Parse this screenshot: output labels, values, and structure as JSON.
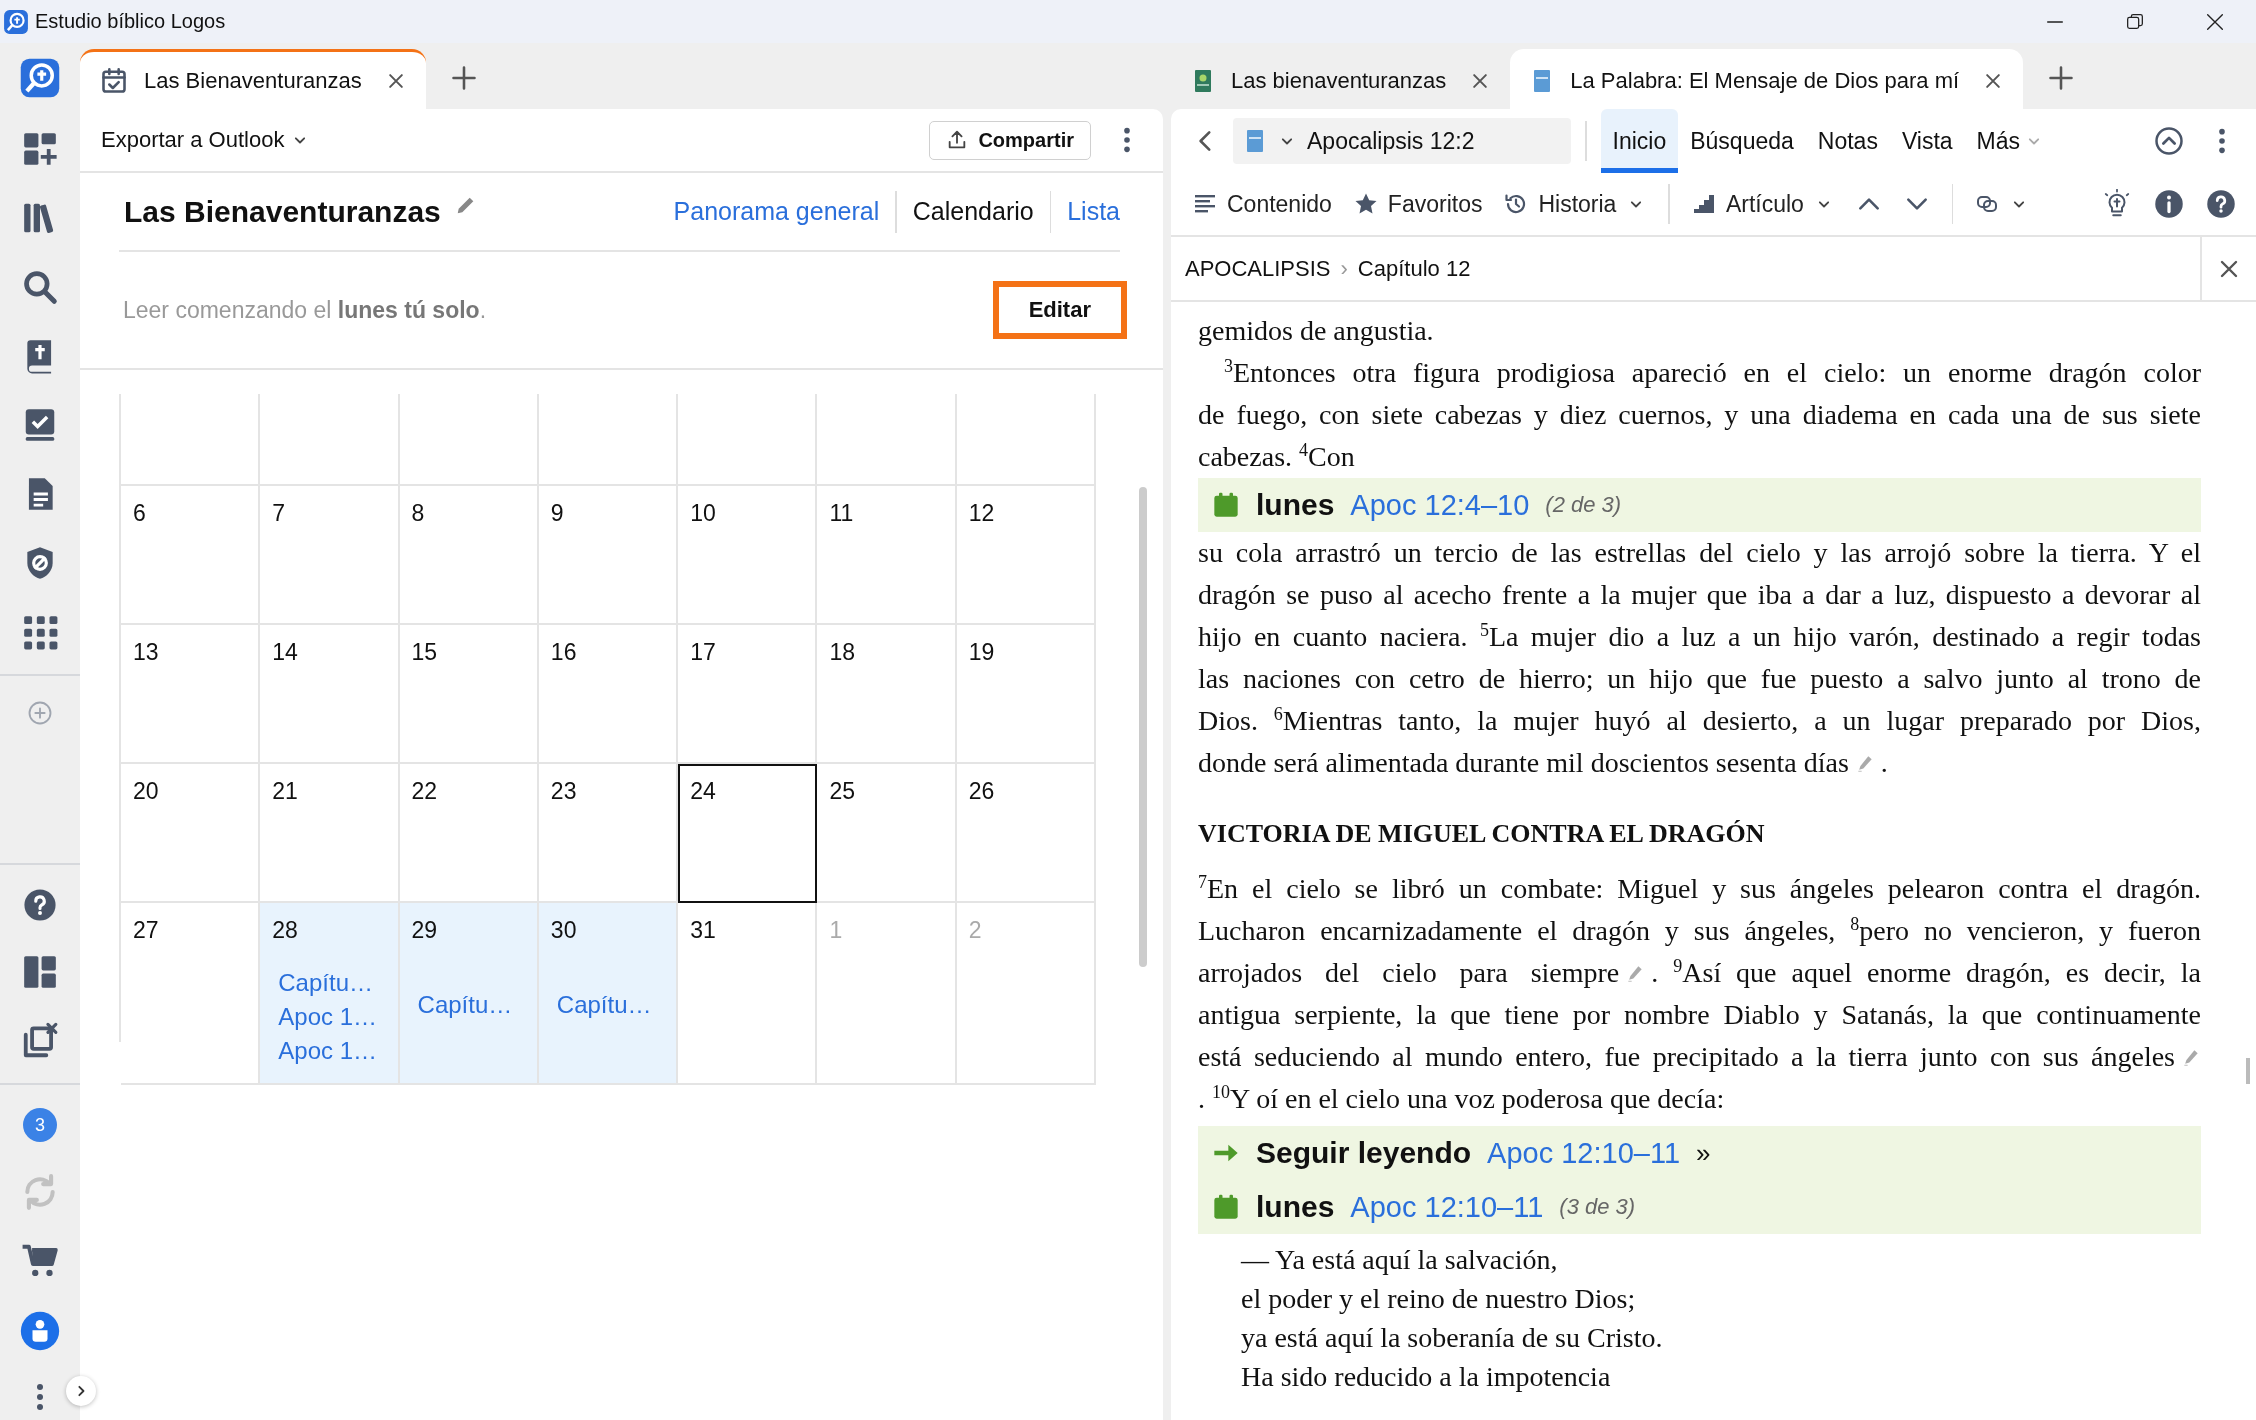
{
  "window": {
    "title": "Estudio bíblico Logos"
  },
  "rail": {
    "top": [
      {
        "kind": "logo"
      },
      {
        "kind": "dashboard"
      },
      {
        "kind": "library"
      },
      {
        "kind": "search"
      },
      {
        "kind": "bible"
      },
      {
        "kind": "tasks"
      },
      {
        "kind": "document"
      },
      {
        "kind": "shield"
      },
      {
        "kind": "apps"
      },
      {
        "kind": "add"
      }
    ],
    "bottom": [
      {
        "kind": "help",
        "disabled": false
      },
      {
        "kind": "layout",
        "disabled": false
      },
      {
        "kind": "close-panels",
        "disabled": false
      },
      {
        "kind": "notifications",
        "count": "3",
        "disabled": false
      },
      {
        "kind": "sync",
        "disabled": true
      },
      {
        "kind": "cart",
        "disabled": false
      },
      {
        "kind": "account",
        "disabled": false
      },
      {
        "kind": "more",
        "disabled": false
      }
    ]
  },
  "left_pane": {
    "tabs": [
      {
        "label": "Las Bienaventuranzas",
        "selected": true
      }
    ],
    "toolbar": {
      "export": "Exportar a Outlook",
      "share": "Compartir"
    },
    "plan": {
      "title": "Las Bienaventuranzas",
      "views": [
        {
          "label": "Panorama general",
          "selected": false
        },
        {
          "label": "Calendario",
          "selected": true
        },
        {
          "label": "Lista",
          "selected": false
        }
      ],
      "schedule": "Leer comenzando el **lunes tú solo**.",
      "edit_button": "Editar"
    },
    "calendar": {
      "weeks": [
        [
          {
            "day": "6",
            "other_month": false,
            "today": false
          },
          {
            "day": "7",
            "other_month": false,
            "today": false
          },
          {
            "day": "8",
            "other_month": false,
            "today": false
          },
          {
            "day": "9",
            "other_month": false,
            "today": false
          },
          {
            "day": "10",
            "other_month": false,
            "today": false
          },
          {
            "day": "11",
            "other_month": false,
            "today": false
          },
          {
            "day": "12",
            "other_month": false,
            "today": false
          }
        ],
        [
          {
            "day": "13",
            "other_month": false,
            "today": false
          },
          {
            "day": "14",
            "other_month": false,
            "today": false
          },
          {
            "day": "15",
            "other_month": false,
            "today": false
          },
          {
            "day": "16",
            "other_month": false,
            "today": false
          },
          {
            "day": "17",
            "other_month": false,
            "today": false
          },
          {
            "day": "18",
            "other_month": false,
            "today": false
          },
          {
            "day": "19",
            "other_month": false,
            "today": false
          }
        ],
        [
          {
            "day": "20",
            "other_month": false,
            "today": false
          },
          {
            "day": "21",
            "other_month": false,
            "today": false
          },
          {
            "day": "22",
            "other_month": false,
            "today": false
          },
          {
            "day": "23",
            "other_month": false,
            "today": false
          },
          {
            "day": "24",
            "other_month": false,
            "today": true
          },
          {
            "day": "25",
            "other_month": false,
            "today": false
          },
          {
            "day": "26",
            "other_month": false,
            "today": false
          }
        ],
        [
          {
            "day": "27",
            "other_month": false,
            "today": false
          },
          {
            "day": "28",
            "other_month": false,
            "today": false,
            "events": [
              "Capítu…",
              "Apoc 1…",
              "Apoc 1…"
            ]
          },
          {
            "day": "29",
            "other_month": false,
            "today": false,
            "events": [
              "Capítu…"
            ]
          },
          {
            "day": "30",
            "other_month": false,
            "today": false,
            "events": [
              "Capítu…"
            ]
          },
          {
            "day": "31",
            "other_month": false,
            "today": false
          },
          {
            "day": "1",
            "other_month": true,
            "today": false
          },
          {
            "day": "2",
            "other_month": true,
            "today": false
          }
        ]
      ]
    }
  },
  "right_pane": {
    "tabs": [
      {
        "label": "Las bienaventuranzas",
        "selected": false
      },
      {
        "label": "La Palabra: El Mensaje de Dios para mí",
        "selected": true
      }
    ],
    "reference": "Apocalipsis 12:2",
    "menu": [
      {
        "label": "Inicio",
        "selected": true
      },
      {
        "label": "Búsqueda",
        "selected": false
      },
      {
        "label": "Notas",
        "selected": false
      },
      {
        "label": "Vista",
        "selected": false
      },
      {
        "label": "Más",
        "selected": false
      }
    ],
    "tools": [
      {
        "kind": "contents",
        "label": "Contenido"
      },
      {
        "kind": "favorites",
        "label": "Favoritos"
      },
      {
        "kind": "history",
        "label": "Historia"
      },
      {
        "kind": "article",
        "label": "Artículo"
      }
    ],
    "breadcrumb": {
      "book": "APOCALIPSIS",
      "separator": "›",
      "chapter": "Capítulo 12"
    },
    "content": [
      {
        "kind": "text",
        "indent": false,
        "lines": [
          {
            "text": "gemidos de angustia.",
            "note": false
          }
        ]
      },
      {
        "kind": "text",
        "indent": true,
        "lines": [
          {
            "text": "$^{3}$Entonces otra figura prodigiosa apareció en el cielo: un enorme dragón color",
            "note": false
          },
          {
            "text": "de fuego, con siete cabezas y diez cuernos, y una diadema en cada una de sus siete",
            "note": false
          },
          {
            "text": "cabezas. $^{4}$Con",
            "note": false
          }
        ]
      },
      {
        "kind": "plan",
        "day": "lunes",
        "reference": "Apoc 12:4–10",
        "count": "(2 de 3)"
      },
      {
        "kind": "text",
        "indent": false,
        "lines": [
          {
            "text": "su cola arrastró un tercio de las estrellas del cielo y las arrojó sobre la tierra. Y el",
            "note": false
          },
          {
            "text": "dragón se puso al acecho frente a la mujer que iba a dar a luz, dispuesto a devorar al",
            "note": false
          },
          {
            "text": "hijo en cuanto naciera. $^{5}$La mujer dio a luz a un hijo varón, destinado a regir todas",
            "note": false
          },
          {
            "text": "las naciones con cetro de hierro; un hijo que fue puesto a salvo junto al trono de",
            "note": false
          },
          {
            "text": "Dios. $^{6}$Mientras tanto, la mujer huyó al desierto, a un lugar preparado por Dios,",
            "note": false
          },
          {
            "text": "donde será alimentada durante mil doscientos sesenta días",
            "note": true,
            "tail": "."
          }
        ]
      },
      {
        "kind": "heading",
        "text": "VICTORIA DE MIGUEL CONTRA EL DRAGÓN"
      },
      {
        "kind": "text",
        "indent": false,
        "lines": [
          {
            "text": "$^{7}$En el cielo se libró un combate: Miguel y sus ángeles pelearon contra el dragón.",
            "note": false
          },
          {
            "text": "Lucharon encarnizadamente el dragón y sus ángeles, $^{8}$pero no vencieron, y fueron",
            "note": false
          },
          {
            "text": "arrojados del cielo para siempre",
            "note": true,
            "tail": ". $^{9}$Así que aquel enorme dragón, es decir, la"
          },
          {
            "text": "antigua serpiente, la que tiene por nombre Diablo y Satanás, la que continuamente",
            "note": false
          },
          {
            "text": "está seduciendo al mundo entero, fue precipitado a la tierra junto con sus ángeles",
            "note": true
          },
          {
            "text": ". $^{10}$Y oí en el cielo una voz poderosa que decía:",
            "note": false
          }
        ]
      },
      {
        "kind": "continue",
        "label": "Seguir leyendo",
        "reference": "Apoc 12:10–11",
        "arrow": "»"
      },
      {
        "kind": "plan",
        "day": "lunes",
        "reference": "Apoc 12:10–11",
        "count": "(3 de 3)"
      },
      {
        "kind": "poetry",
        "lines": [
          "— Ya está aquí la salvación,",
          "el poder y el reino de nuestro Dios;",
          "ya está aquí la soberanía de su Cristo.",
          "Ha sido reducido a la impotencia"
        ]
      }
    ]
  }
}
